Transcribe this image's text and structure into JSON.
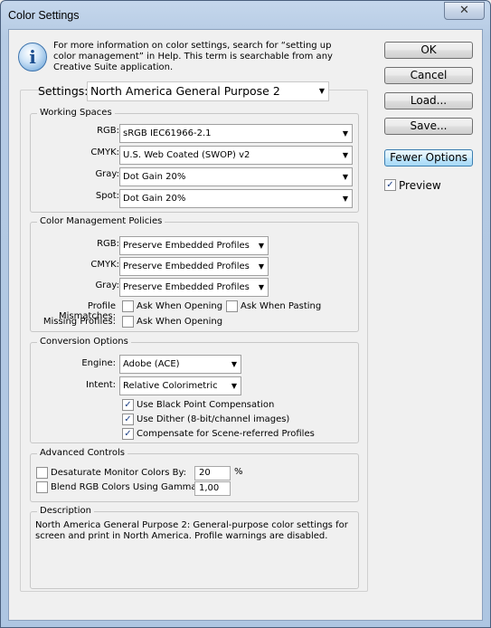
{
  "window": {
    "title": "Color Settings",
    "close_glyph": "✕"
  },
  "info": {
    "icon": "info-icon",
    "text": "For more information on color settings, search for “setting up color management” in Help. This term is searchable from any Creative Suite application."
  },
  "settings": {
    "label": "Settings:",
    "value": "North America General Purpose 2"
  },
  "working_spaces": {
    "title": "Working Spaces",
    "rgb_label": "RGB:",
    "rgb_value": "sRGB IEC61966-2.1",
    "cmyk_label": "CMYK:",
    "cmyk_value": "U.S. Web Coated (SWOP) v2",
    "gray_label": "Gray:",
    "gray_value": "Dot Gain 20%",
    "spot_label": "Spot:",
    "spot_value": "Dot Gain 20%"
  },
  "policies": {
    "title": "Color Management Policies",
    "rgb_label": "RGB:",
    "rgb_value": "Preserve Embedded Profiles",
    "cmyk_label": "CMYK:",
    "cmyk_value": "Preserve Embedded Profiles",
    "gray_label": "Gray:",
    "gray_value": "Preserve Embedded Profiles",
    "mismatch_label": "Profile Mismatches:",
    "ask_opening": "Ask When Opening",
    "ask_pasting": "Ask When Pasting",
    "missing_label": "Missing Profiles:",
    "missing_ask_opening": "Ask When Opening"
  },
  "conversion": {
    "title": "Conversion Options",
    "engine_label": "Engine:",
    "engine_value": "Adobe (ACE)",
    "intent_label": "Intent:",
    "intent_value": "Relative Colorimetric",
    "black_point": "Use Black Point Compensation",
    "dither": "Use Dither (8-bit/channel images)",
    "scene_referred": "Compensate for Scene-referred Profiles"
  },
  "advanced": {
    "title": "Advanced Controls",
    "desaturate_label": "Desaturate Monitor Colors By:",
    "desaturate_value": "20",
    "desaturate_unit": "%",
    "blend_label": "Blend RGB Colors Using Gamma:",
    "blend_value": "1,00"
  },
  "description": {
    "title": "Description",
    "text": "North America General Purpose 2:  General-purpose color settings for screen and print in North America. Profile warnings are disabled."
  },
  "buttons": {
    "ok": "OK",
    "cancel": "Cancel",
    "load": "Load...",
    "save": "Save...",
    "fewer_options": "Fewer Options"
  },
  "preview": {
    "label": "Preview",
    "checked": true
  },
  "checkmark": "✓",
  "dropdown_arrow": "▼"
}
